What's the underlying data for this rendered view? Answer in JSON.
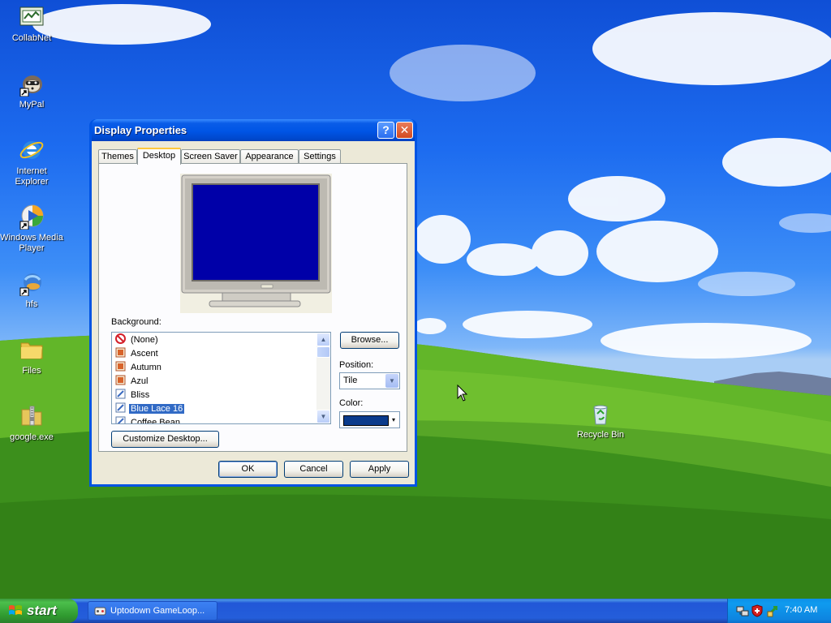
{
  "desktop_icons": [
    {
      "label": "CollabNet"
    },
    {
      "label": "MyPal"
    },
    {
      "label": "Internet Explorer"
    },
    {
      "label": "Windows Media Player"
    },
    {
      "label": "hfs"
    },
    {
      "label": "Files"
    },
    {
      "label": "google.exe"
    },
    {
      "label": "Recycle Bin"
    }
  ],
  "window": {
    "title": "Display Properties",
    "help_glyph": "?",
    "close_glyph": "✕",
    "tabs": [
      {
        "label": "Themes",
        "active": false
      },
      {
        "label": "Desktop",
        "active": true
      },
      {
        "label": "Screen Saver",
        "active": false
      },
      {
        "label": "Appearance",
        "active": false
      },
      {
        "label": "Settings",
        "active": false
      }
    ],
    "background_label": "Background:",
    "background_items": [
      {
        "label": "(None)",
        "icon": "none-icon"
      },
      {
        "label": "Ascent",
        "icon": "picture-icon"
      },
      {
        "label": "Autumn",
        "icon": "picture-icon"
      },
      {
        "label": "Azul",
        "icon": "picture-icon"
      },
      {
        "label": "Bliss",
        "icon": "bitmap-icon"
      },
      {
        "label": "Blue Lace 16",
        "icon": "bitmap-icon",
        "selected": true
      },
      {
        "label": "Coffee Bean",
        "icon": "bitmap-icon"
      }
    ],
    "browse_label": "Browse...",
    "position_label": "Position:",
    "position_value": "Tile",
    "color_label": "Color:",
    "color_value": "#0a3b8c",
    "customize_label": "Customize Desktop...",
    "ok_label": "OK",
    "cancel_label": "Cancel",
    "apply_label": "Apply",
    "preview_screen_color": "#0000a8"
  },
  "taskbar": {
    "start_label": "start",
    "task_item_label": "Uptodown GameLoop...",
    "clock": "7:40 AM"
  }
}
